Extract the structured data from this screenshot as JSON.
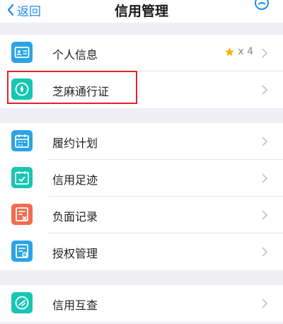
{
  "nav": {
    "back_label": "返回",
    "title": "信用管理"
  },
  "groups": [
    {
      "items": [
        {
          "label": "个人信息",
          "icon": "id-card-icon",
          "color": "#2aa4e6",
          "stars": "x 4"
        },
        {
          "label": "芝麻通行证",
          "icon": "zhima-icon",
          "color": "#16c6b3"
        }
      ]
    },
    {
      "items": [
        {
          "label": "履约计划",
          "icon": "calendar-icon",
          "color": "#2aa4e6"
        },
        {
          "label": "信用足迹",
          "icon": "footprint-icon",
          "color": "#16c6b3"
        },
        {
          "label": "负面记录",
          "icon": "negative-record-icon",
          "color": "#f26b4f"
        },
        {
          "label": "授权管理",
          "icon": "authorization-icon",
          "color": "#2aa4e6"
        }
      ]
    },
    {
      "items": [
        {
          "label": "信用互查",
          "icon": "mutual-check-icon",
          "color": "#16c6b3"
        }
      ]
    }
  ],
  "colors": {
    "accent": "#1e8cef",
    "highlight": "#e2232a",
    "star": "#f5b400"
  }
}
